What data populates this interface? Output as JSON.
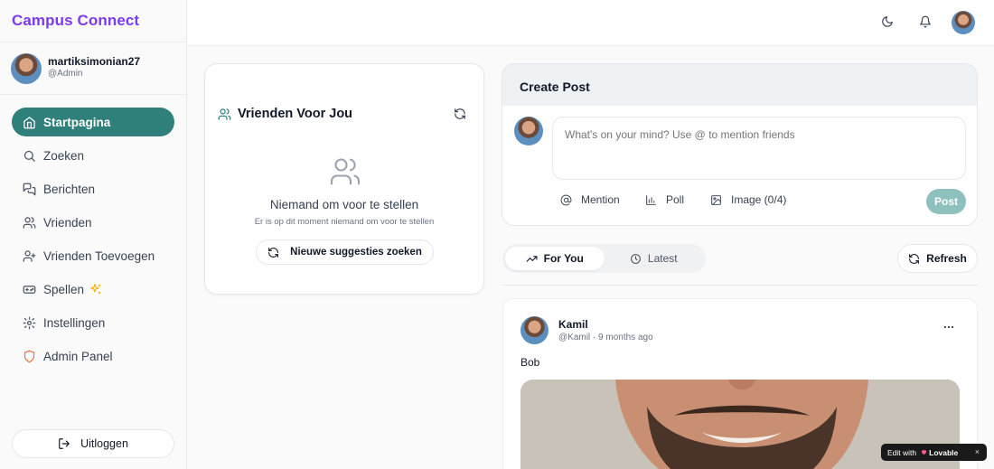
{
  "app": {
    "title": "Campus Connect"
  },
  "user": {
    "username": "martiksimonian27",
    "handle": "@Admin"
  },
  "sidebar": {
    "items": [
      {
        "label": "Startpagina",
        "icon": "home-icon",
        "active": true
      },
      {
        "label": "Zoeken",
        "icon": "search-icon"
      },
      {
        "label": "Berichten",
        "icon": "messages-icon"
      },
      {
        "label": "Vrienden",
        "icon": "users-icon"
      },
      {
        "label": "Vrienden Toevoegen",
        "icon": "user-plus-icon"
      },
      {
        "label": "Spellen",
        "icon": "gamepad-icon",
        "badge_icon": "sparkles-icon"
      },
      {
        "label": "Instellingen",
        "icon": "gear-icon"
      },
      {
        "label": "Admin Panel",
        "icon": "shield-icon",
        "icon_color": "#f0754a"
      }
    ],
    "logout_label": "Uitloggen"
  },
  "topbar": {
    "icons": [
      "moon-icon",
      "bell-icon",
      "avatar"
    ]
  },
  "friends": {
    "title": "Vrienden Voor Jou",
    "empty_title": "Niemand om voor te stellen",
    "empty_subtitle": "Er is op dit moment niemand om voor te stellen",
    "button_label": "Nieuwe suggesties zoeken"
  },
  "create_post": {
    "title": "Create Post",
    "placeholder": "What's on your mind? Use @ to mention friends",
    "tools": {
      "mention": "Mention",
      "poll": "Poll",
      "image": "Image (0/4)"
    },
    "post_label": "Post"
  },
  "feed": {
    "tabs": [
      {
        "label": "For You",
        "active": true
      },
      {
        "label": "Latest"
      }
    ],
    "refresh_label": "Refresh"
  },
  "post": {
    "author": "Kamil",
    "meta": "@Kamil · 9 months ago",
    "body": "Bob"
  },
  "badge": {
    "prefix": "Edit with",
    "brand": "Lovable",
    "close": "×"
  },
  "colors": {
    "brand": "#7c3aed",
    "accent": "#2f7f7a",
    "post_button": "#8ec1bd",
    "admin_icon": "#f0754a"
  }
}
